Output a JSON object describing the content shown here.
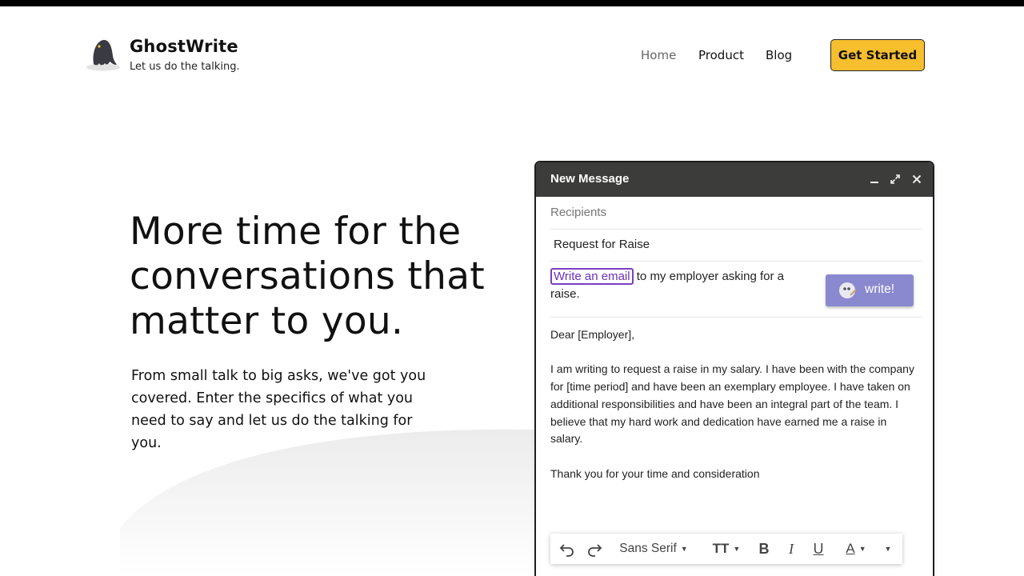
{
  "brand": {
    "name": "GhostWrite",
    "tagline": "Let us do the talking."
  },
  "nav": {
    "home": "Home",
    "product": "Product",
    "blog": "Blog",
    "cta": "Get Started"
  },
  "hero": {
    "title": "More time for the conversations that matter to you.",
    "subtitle": "From small talk to big asks, we've got you covered. Enter the specifics of what you need to say and let us do the talking for you."
  },
  "mail": {
    "title": "New Message",
    "recipients_placeholder": "Recipients",
    "subject": "Request for Raise",
    "prompt_chip": "Write an email",
    "prompt_rest": " to my employer asking for a raise.",
    "write_button": "write!",
    "body": {
      "greeting": "Dear [Employer],",
      "paragraph": "I am writing to request a raise in my salary. I have been with the company for [time period] and have been an exemplary employee. I have taken on additional responsibilities and have been an integral part of the team. I believe that my hard work and dedication have earned me a raise in salary.",
      "closing": "Thank you for your time and consideration"
    },
    "toolbar": {
      "font": "Sans Serif",
      "size_icon": "TT",
      "bold": "B",
      "italic": "I",
      "underline": "U",
      "text_color": "A"
    }
  },
  "colors": {
    "cta_bg": "#f7be2e",
    "mail_header": "#3c3d3a",
    "write_button": "#8a89cf",
    "prompt_chip": "#7b3fc4"
  }
}
